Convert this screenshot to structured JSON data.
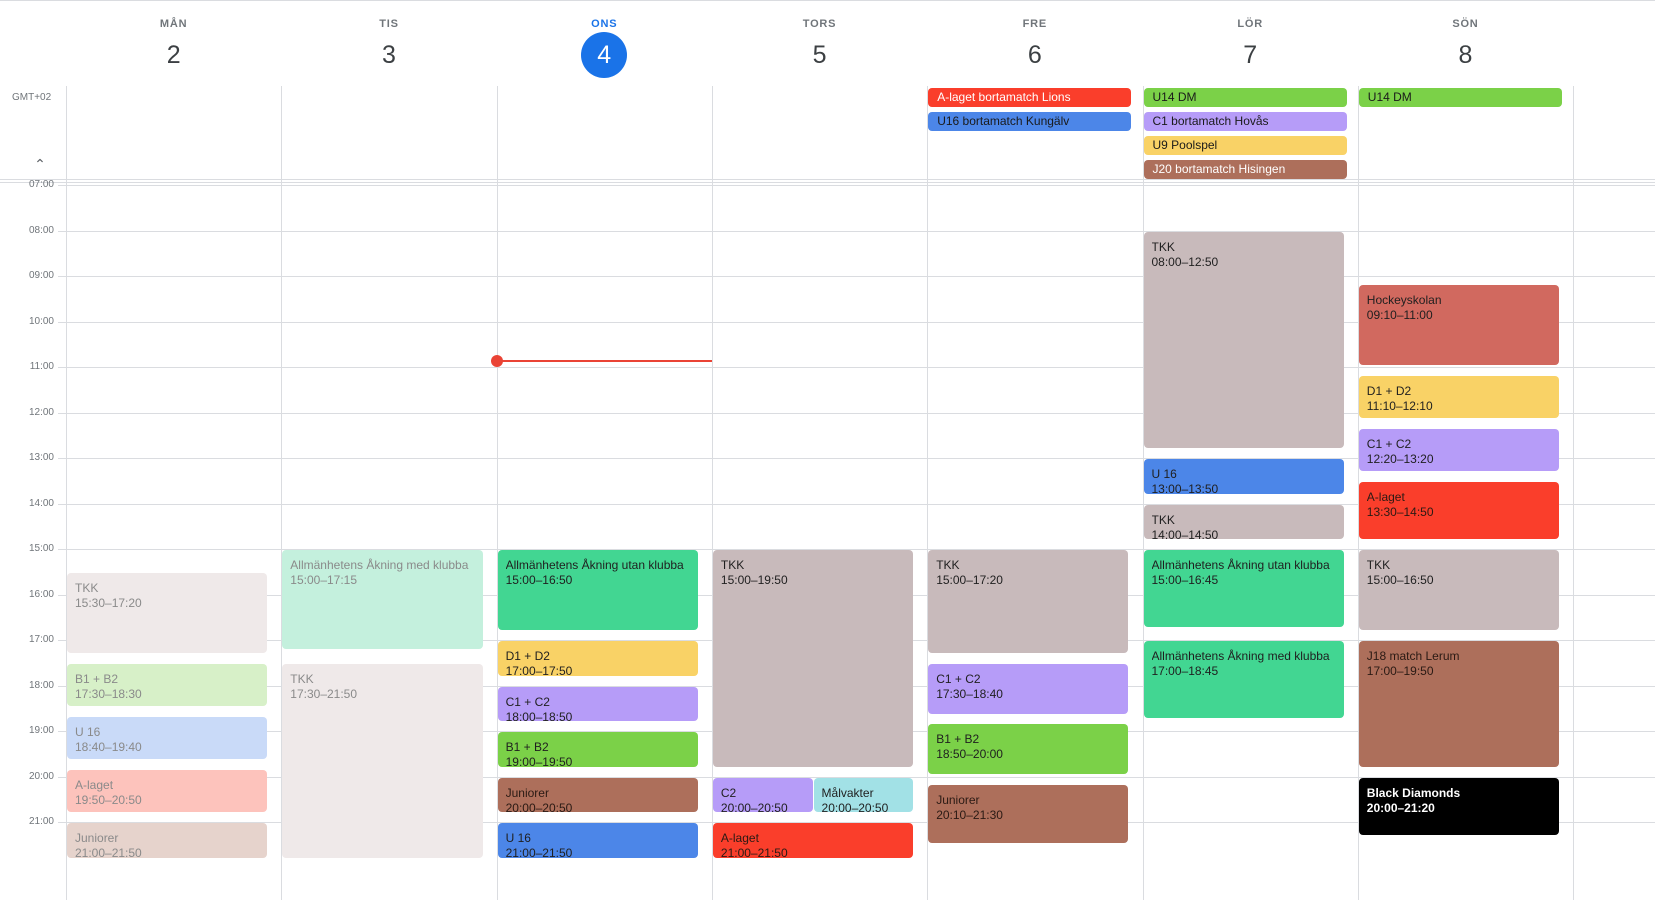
{
  "header": {
    "days": [
      {
        "dow": "MÅN",
        "num": "2"
      },
      {
        "dow": "TIS",
        "num": "3"
      },
      {
        "dow": "ONS",
        "num": "4"
      },
      {
        "dow": "TORS",
        "num": "5"
      },
      {
        "dow": "FRE",
        "num": "6"
      },
      {
        "dow": "LÖR",
        "num": "7"
      },
      {
        "dow": "SÖN",
        "num": "8"
      }
    ],
    "today_index": 2
  },
  "timezone_label": "GMT+02",
  "collapse_icon": "chevron-up-icon",
  "time_labels": [
    "07:00",
    "08:00",
    "09:00",
    "10:00",
    "11:00",
    "12:00",
    "13:00",
    "14:00",
    "15:00",
    "16:00",
    "17:00",
    "18:00",
    "19:00",
    "20:00",
    "21:00"
  ],
  "colors": {
    "red": "#fa3e2b",
    "blue": "#4c86e8",
    "green": "#7bd148",
    "lavender": "#b69cf8",
    "yellow": "#f9d266",
    "brown": "#ad6f5b",
    "taupe": "#c8babb",
    "emerald": "#42d692",
    "salmon": "#d1695f",
    "black": "#000000",
    "cyan": "#a2e1e6",
    "pale_taupe": "#efe9e9",
    "pale_mint": "#c4f0dd",
    "pale_green": "#d7f0c8",
    "pale_blue": "#c9daf8",
    "pale_red": "#fdc3bc",
    "pale_brown": "#e6d3cc",
    "today_blue": "#1a73e8",
    "now_red": "#ea4335"
  },
  "allday_events": [
    {
      "day": 4,
      "row": 0,
      "title": "A-laget bortamatch Lions",
      "color": "red"
    },
    {
      "day": 4,
      "row": 1,
      "title": "U16 bortamatch Kungälv",
      "color": "blue"
    },
    {
      "day": 5,
      "row": 0,
      "title": "U14 DM",
      "color": "green"
    },
    {
      "day": 5,
      "row": 1,
      "title": "C1 bortamatch Hovås",
      "color": "lavender"
    },
    {
      "day": 5,
      "row": 2,
      "title": "U9 Poolspel",
      "color": "yellow"
    },
    {
      "day": 5,
      "row": 3,
      "title": "J20 bortamatch Hisingen",
      "color": "brown"
    },
    {
      "day": 6,
      "row": 0,
      "title": "U14 DM",
      "color": "green"
    }
  ],
  "events": [
    {
      "day": 0,
      "col": 0,
      "cols": 1,
      "start": "15:30",
      "end": "17:20",
      "title": "TKK",
      "time": "15:30–17:20",
      "color": "pale_taupe",
      "past": true
    },
    {
      "day": 0,
      "col": 0,
      "cols": 1,
      "start": "17:30",
      "end": "18:30",
      "title": "B1 + B2",
      "time": "17:30–18:30",
      "color": "pale_green",
      "past": true
    },
    {
      "day": 0,
      "col": 0,
      "cols": 1,
      "start": "18:40",
      "end": "19:40",
      "title": "U 16",
      "time": "18:40–19:40",
      "color": "pale_blue",
      "past": true
    },
    {
      "day": 0,
      "col": 0,
      "cols": 1,
      "start": "19:50",
      "end": "20:50",
      "title": "A-laget",
      "time": "19:50–20:50",
      "color": "pale_red",
      "past": true
    },
    {
      "day": 0,
      "col": 0,
      "cols": 1,
      "start": "21:00",
      "end": "21:50",
      "title": "Juniorer",
      "time": "21:00–21:50",
      "color": "pale_brown",
      "past": true
    },
    {
      "day": 1,
      "col": 0,
      "cols": 1,
      "start": "15:00",
      "end": "17:15",
      "title": "Allmänhetens Åkning med klubba",
      "time": "15:00–17:15",
      "color": "pale_mint",
      "past": true
    },
    {
      "day": 1,
      "col": 0,
      "cols": 1,
      "start": "17:30",
      "end": "21:50",
      "title": "TKK",
      "time": "17:30–21:50",
      "color": "pale_taupe",
      "past": true
    },
    {
      "day": 2,
      "col": 0,
      "cols": 1,
      "start": "15:00",
      "end": "16:50",
      "title": "Allmänhetens Åkning utan klubba",
      "time": "15:00–16:50",
      "color": "emerald"
    },
    {
      "day": 2,
      "col": 0,
      "cols": 1,
      "start": "17:00",
      "end": "17:50",
      "title": "D1 + D2",
      "time": "17:00–17:50",
      "color": "yellow"
    },
    {
      "day": 2,
      "col": 0,
      "cols": 1,
      "start": "18:00",
      "end": "18:50",
      "title": "C1 + C2",
      "time": "18:00–18:50",
      "color": "lavender"
    },
    {
      "day": 2,
      "col": 0,
      "cols": 1,
      "start": "19:00",
      "end": "19:50",
      "title": "B1 + B2",
      "time": "19:00–19:50",
      "color": "green"
    },
    {
      "day": 2,
      "col": 0,
      "cols": 1,
      "start": "20:00",
      "end": "20:50",
      "title": "Juniorer",
      "time": "20:00–20:50",
      "color": "brown"
    },
    {
      "day": 2,
      "col": 0,
      "cols": 1,
      "start": "21:00",
      "end": "21:50",
      "title": "U 16",
      "time": "21:00–21:50",
      "color": "blue"
    },
    {
      "day": 3,
      "col": 0,
      "cols": 1,
      "start": "15:00",
      "end": "19:50",
      "title": "TKK",
      "time": "15:00–19:50",
      "color": "taupe"
    },
    {
      "day": 3,
      "col": 0,
      "cols": 2,
      "start": "20:00",
      "end": "20:50",
      "title": "C2",
      "time": "20:00–20:50",
      "color": "lavender"
    },
    {
      "day": 3,
      "col": 1,
      "cols": 2,
      "start": "20:00",
      "end": "20:50",
      "title": "Målvakter",
      "time": "20:00–20:50",
      "color": "cyan"
    },
    {
      "day": 3,
      "col": 0,
      "cols": 1,
      "start": "21:00",
      "end": "21:50",
      "title": "A-laget",
      "time": "21:00–21:50",
      "color": "red"
    },
    {
      "day": 4,
      "col": 0,
      "cols": 1,
      "start": "15:00",
      "end": "17:20",
      "title": "TKK",
      "time": "15:00–17:20",
      "color": "taupe"
    },
    {
      "day": 4,
      "col": 0,
      "cols": 1,
      "start": "17:30",
      "end": "18:40",
      "title": "C1 + C2",
      "time": "17:30–18:40",
      "color": "lavender"
    },
    {
      "day": 4,
      "col": 0,
      "cols": 1,
      "start": "18:50",
      "end": "20:00",
      "title": "B1 + B2",
      "time": "18:50–20:00",
      "color": "green"
    },
    {
      "day": 4,
      "col": 0,
      "cols": 1,
      "start": "20:10",
      "end": "21:30",
      "title": "Juniorer",
      "time": "20:10–21:30",
      "color": "brown"
    },
    {
      "day": 5,
      "col": 0,
      "cols": 1,
      "start": "08:00",
      "end": "12:50",
      "title": "TKK",
      "time": "08:00–12:50",
      "color": "taupe"
    },
    {
      "day": 5,
      "col": 0,
      "cols": 1,
      "start": "13:00",
      "end": "13:50",
      "title": "U 16",
      "time": "13:00–13:50",
      "color": "blue"
    },
    {
      "day": 5,
      "col": 0,
      "cols": 1,
      "start": "14:00",
      "end": "14:50",
      "title": "TKK",
      "time": "14:00–14:50",
      "color": "taupe"
    },
    {
      "day": 5,
      "col": 0,
      "cols": 1,
      "start": "15:00",
      "end": "16:45",
      "title": "Allmänhetens Åkning utan klubba",
      "time": "15:00–16:45",
      "color": "emerald"
    },
    {
      "day": 5,
      "col": 0,
      "cols": 1,
      "start": "17:00",
      "end": "18:45",
      "title": "Allmänhetens Åkning med klubba",
      "time": "17:00–18:45",
      "color": "emerald"
    },
    {
      "day": 6,
      "col": 0,
      "cols": 1,
      "start": "09:10",
      "end": "11:00",
      "title": "Hockeyskolan",
      "time": "09:10–11:00",
      "color": "salmon"
    },
    {
      "day": 6,
      "col": 0,
      "cols": 1,
      "start": "11:10",
      "end": "12:10",
      "title": "D1 + D2",
      "time": "11:10–12:10",
      "color": "yellow"
    },
    {
      "day": 6,
      "col": 0,
      "cols": 1,
      "start": "12:20",
      "end": "13:20",
      "title": "C1 + C2",
      "time": "12:20–13:20",
      "color": "lavender"
    },
    {
      "day": 6,
      "col": 0,
      "cols": 1,
      "start": "13:30",
      "end": "14:50",
      "title": "A-laget",
      "time": "13:30–14:50",
      "color": "red"
    },
    {
      "day": 6,
      "col": 0,
      "cols": 1,
      "start": "15:00",
      "end": "16:50",
      "title": "TKK",
      "time": "15:00–16:50",
      "color": "taupe"
    },
    {
      "day": 6,
      "col": 0,
      "cols": 1,
      "start": "17:00",
      "end": "19:50",
      "title": "J18 match Lerum",
      "time": "17:00–19:50",
      "color": "brown"
    },
    {
      "day": 6,
      "col": 0,
      "cols": 1,
      "start": "20:00",
      "end": "21:20",
      "title": "Black Diamonds",
      "time": "20:00–21:20",
      "color": "black"
    }
  ],
  "now": {
    "day": 2,
    "time": "10:52"
  }
}
